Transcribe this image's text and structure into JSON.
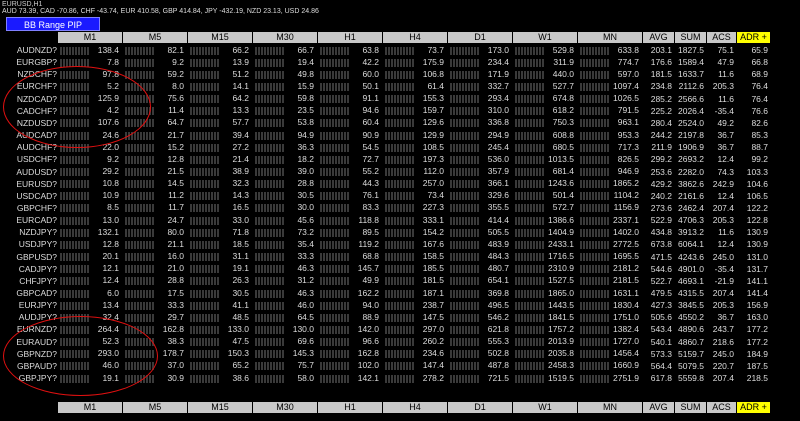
{
  "window": {
    "title": "EURUSD,H1",
    "ticker": "AUD 73.39, CAD -70.86, CHF -43.74, EUR 410.58, GBP 414.84, JPY -432.19, NZD 23.13, USD 24.86",
    "button_label": "BB Range PIP"
  },
  "headers": [
    "M1",
    "M5",
    "M15",
    "M30",
    "H1",
    "H4",
    "D1",
    "W1",
    "MN",
    "AVG",
    "SUM",
    "ACS",
    "ADR +"
  ],
  "rows": [
    {
      "sym": "AUDNZD?",
      "v": [
        "138.4",
        "82.1",
        "66.2",
        "66.7",
        "63.8",
        "73.7",
        "173.0",
        "529.8",
        "633.8"
      ],
      "avg": "203.1",
      "sum": "1827.5",
      "acs": "75.1",
      "adr": "65.9"
    },
    {
      "sym": "EURGBP?",
      "v": [
        "7.8",
        "9.2",
        "13.9",
        "19.4",
        "42.2",
        "175.9",
        "234.4",
        "311.9",
        "774.7"
      ],
      "avg": "176.6",
      "sum": "1589.4",
      "acs": "47.9",
      "adr": "66.8"
    },
    {
      "sym": "NZDCHF?",
      "v": [
        "97.8",
        "59.2",
        "51.2",
        "49.8",
        "60.0",
        "106.8",
        "171.9",
        "440.0",
        "597.0"
      ],
      "avg": "181.5",
      "sum": "1633.7",
      "acs": "11.6",
      "adr": "68.9"
    },
    {
      "sym": "EURCHF?",
      "v": [
        "5.2",
        "8.0",
        "14.1",
        "15.9",
        "50.1",
        "61.4",
        "332.7",
        "527.7",
        "1097.4"
      ],
      "avg": "234.8",
      "sum": "2112.6",
      "acs": "205.3",
      "adr": "76.4"
    },
    {
      "sym": "NZDCAD?",
      "v": [
        "125.9",
        "75.6",
        "64.2",
        "59.8",
        "91.1",
        "155.3",
        "293.4",
        "674.8",
        "1026.5"
      ],
      "avg": "285.2",
      "sum": "2566.6",
      "acs": "11.6",
      "adr": "76.4"
    },
    {
      "sym": "CADCHF?",
      "v": [
        "4.2",
        "11.4",
        "13.3",
        "23.5",
        "94.6",
        "159.7",
        "310.0",
        "618.2",
        "791.5"
      ],
      "avg": "225.2",
      "sum": "2026.4",
      "acs": "-35.4",
      "adr": "76.6"
    },
    {
      "sym": "NZDUSD?",
      "v": [
        "107.6",
        "64.7",
        "57.7",
        "53.8",
        "60.4",
        "129.6",
        "336.8",
        "750.3",
        "963.1"
      ],
      "avg": "280.4",
      "sum": "2524.0",
      "acs": "49.2",
      "adr": "82.6"
    },
    {
      "sym": "AUDCAD?",
      "v": [
        "24.6",
        "21.7",
        "39.4",
        "94.9",
        "90.9",
        "129.9",
        "294.9",
        "608.8",
        "953.3"
      ],
      "avg": "244.2",
      "sum": "2197.8",
      "acs": "36.7",
      "adr": "85.3"
    },
    {
      "sym": "AUDCHF?",
      "v": [
        "22.0",
        "15.2",
        "27.2",
        "36.3",
        "54.5",
        "108.5",
        "245.4",
        "680.5",
        "717.3"
      ],
      "avg": "211.9",
      "sum": "1906.9",
      "acs": "36.7",
      "adr": "88.7"
    },
    {
      "sym": "USDCHF?",
      "v": [
        "9.2",
        "12.8",
        "21.4",
        "18.2",
        "72.7",
        "197.3",
        "536.0",
        "1013.5",
        "826.5"
      ],
      "avg": "299.2",
      "sum": "2693.2",
      "acs": "12.4",
      "adr": "99.2"
    },
    {
      "sym": "AUDUSD?",
      "v": [
        "29.2",
        "21.5",
        "38.9",
        "39.0",
        "55.2",
        "112.0",
        "357.9",
        "681.4",
        "946.9"
      ],
      "avg": "253.6",
      "sum": "2282.0",
      "acs": "74.3",
      "adr": "103.3"
    },
    {
      "sym": "EURUSD?",
      "v": [
        "10.8",
        "14.5",
        "32.3",
        "28.8",
        "44.3",
        "257.0",
        "366.1",
        "1243.6",
        "1865.2"
      ],
      "avg": "429.2",
      "sum": "3862.6",
      "acs": "242.9",
      "adr": "104.6"
    },
    {
      "sym": "USDCAD?",
      "v": [
        "10.9",
        "11.2",
        "14.3",
        "30.5",
        "76.1",
        "73.4",
        "329.6",
        "501.4",
        "1104.2"
      ],
      "avg": "240.2",
      "sum": "2161.6",
      "acs": "12.4",
      "adr": "106.5"
    },
    {
      "sym": "GBPCHF?",
      "v": [
        "8.5",
        "11.7",
        "16.5",
        "30.0",
        "83.3",
        "227.3",
        "355.5",
        "572.7",
        "1156.9"
      ],
      "avg": "273.6",
      "sum": "2462.4",
      "acs": "207.4",
      "adr": "122.2"
    },
    {
      "sym": "EURCAD?",
      "v": [
        "13.0",
        "24.7",
        "33.0",
        "45.6",
        "118.8",
        "333.1",
        "414.4",
        "1386.6",
        "2337.1"
      ],
      "avg": "522.9",
      "sum": "4706.3",
      "acs": "205.3",
      "adr": "122.8"
    },
    {
      "sym": "NZDJPY?",
      "v": [
        "132.1",
        "80.0",
        "71.8",
        "73.2",
        "89.5",
        "154.2",
        "505.5",
        "1404.9",
        "1402.0"
      ],
      "avg": "434.8",
      "sum": "3913.2",
      "acs": "11.6",
      "adr": "130.9"
    },
    {
      "sym": "USDJPY?",
      "v": [
        "12.8",
        "21.1",
        "18.5",
        "35.4",
        "119.2",
        "167.6",
        "483.9",
        "2433.1",
        "2772.5"
      ],
      "avg": "673.8",
      "sum": "6064.1",
      "acs": "12.4",
      "adr": "130.9"
    },
    {
      "sym": "GBPUSD?",
      "v": [
        "20.1",
        "16.0",
        "31.1",
        "33.3",
        "68.8",
        "158.5",
        "484.3",
        "1716.5",
        "1695.5"
      ],
      "avg": "471.5",
      "sum": "4243.6",
      "acs": "245.0",
      "adr": "131.0"
    },
    {
      "sym": "CADJPY?",
      "v": [
        "12.1",
        "21.0",
        "19.1",
        "46.3",
        "145.7",
        "185.5",
        "480.7",
        "2310.9",
        "2181.2"
      ],
      "avg": "544.6",
      "sum": "4901.0",
      "acs": "-35.4",
      "adr": "131.7"
    },
    {
      "sym": "CHFJPY?",
      "v": [
        "12.4",
        "28.8",
        "26.3",
        "31.2",
        "49.9",
        "181.5",
        "654.1",
        "1527.5",
        "2181.5"
      ],
      "avg": "522.7",
      "sum": "4693.1",
      "acs": "-21.9",
      "adr": "141.1"
    },
    {
      "sym": "GBPCAD?",
      "v": [
        "6.0",
        "17.5",
        "30.5",
        "46.3",
        "162.2",
        "187.1",
        "369.8",
        "1865.0",
        "1631.1"
      ],
      "avg": "479.5",
      "sum": "4315.5",
      "acs": "207.4",
      "adr": "141.4"
    },
    {
      "sym": "EURJPY?",
      "v": [
        "13.4",
        "33.3",
        "41.1",
        "46.0",
        "94.0",
        "238.7",
        "496.5",
        "1443.5",
        "1830.4"
      ],
      "avg": "427.3",
      "sum": "3845.5",
      "acs": "205.3",
      "adr": "156.9"
    },
    {
      "sym": "AUDJPY?",
      "v": [
        "32.4",
        "29.7",
        "48.5",
        "64.5",
        "88.9",
        "147.5",
        "546.2",
        "1841.5",
        "1751.0"
      ],
      "avg": "505.6",
      "sum": "4550.2",
      "acs": "36.7",
      "adr": "163.0"
    },
    {
      "sym": "EURNZD?",
      "v": [
        "264.4",
        "162.8",
        "133.0",
        "130.0",
        "142.0",
        "297.0",
        "621.8",
        "1757.2",
        "1382.4"
      ],
      "avg": "543.4",
      "sum": "4890.6",
      "acs": "243.7",
      "adr": "177.2"
    },
    {
      "sym": "EURAUD?",
      "v": [
        "52.3",
        "38.3",
        "47.5",
        "69.6",
        "96.6",
        "260.2",
        "555.3",
        "2013.9",
        "1727.0"
      ],
      "avg": "540.1",
      "sum": "4860.7",
      "acs": "218.6",
      "adr": "177.2"
    },
    {
      "sym": "GBPNZD?",
      "v": [
        "293.0",
        "178.7",
        "150.3",
        "145.3",
        "162.8",
        "234.6",
        "502.8",
        "2035.8",
        "1456.4"
      ],
      "avg": "573.3",
      "sum": "5159.7",
      "acs": "245.0",
      "adr": "184.9"
    },
    {
      "sym": "GBPAUD?",
      "v": [
        "46.0",
        "37.0",
        "65.2",
        "75.7",
        "102.0",
        "147.4",
        "487.8",
        "2458.3",
        "1660.9"
      ],
      "avg": "564.4",
      "sum": "5079.5",
      "acs": "220.7",
      "adr": "187.5"
    },
    {
      "sym": "GBPJPY?",
      "v": [
        "19.1",
        "30.9",
        "38.6",
        "58.0",
        "142.1",
        "278.2",
        "721.5",
        "1519.5",
        "2751.9"
      ],
      "avg": "617.8",
      "sum": "5559.8",
      "acs": "207.4",
      "adr": "218.5"
    }
  ]
}
